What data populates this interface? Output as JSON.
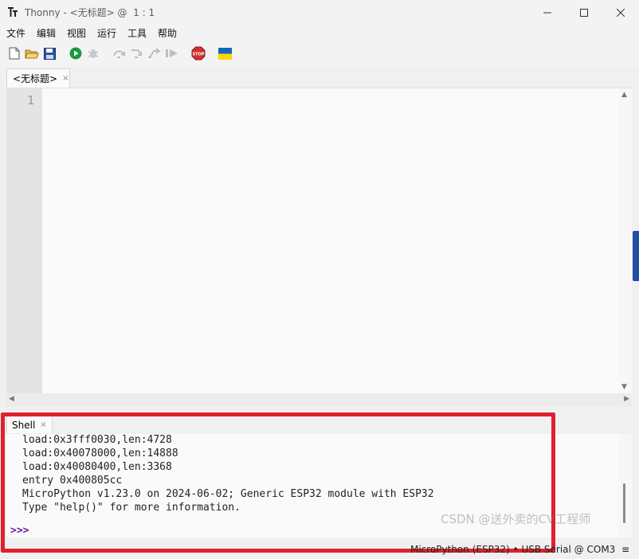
{
  "window": {
    "app_name": "Thonny",
    "separator": "-",
    "document": "<无标题>",
    "position": "@  1 : 1"
  },
  "menu": [
    "文件",
    "编辑",
    "视图",
    "运行",
    "工具",
    "帮助"
  ],
  "toolbar_icons": [
    "new-file-icon",
    "open-file-icon",
    "save-icon",
    "run-icon",
    "debug-icon",
    "step-over-icon",
    "step-into-icon",
    "step-out-icon",
    "resume-icon",
    "stop-icon",
    "ukraine-flag-icon"
  ],
  "stop_label": "STOP",
  "editor": {
    "tab_label": "<无标题>",
    "tab_close": "×",
    "line_numbers": [
      "1"
    ]
  },
  "shell": {
    "tab_label": "Shell",
    "tab_close": "×",
    "lines": [
      "load:0x3fff0030,len:4728",
      "load:0x40078000,len:14888",
      "load:0x40080400,len:3368",
      "entry 0x400805cc",
      "MicroPython v1.23.0 on 2024-06-02; Generic ESP32 module with ESP32",
      "Type \"help()\" for more information."
    ],
    "prompt": ">>>"
  },
  "status": {
    "interpreter": "MicroPython (ESP32) • USB Serial @ COM3  ≡"
  },
  "watermark": "CSDN @送外卖的CV工程师",
  "colors": {
    "highlight": "#e0212e",
    "prompt": "#6a1b9a",
    "run": "#1a9b3c",
    "stop": "#d32f2f"
  }
}
